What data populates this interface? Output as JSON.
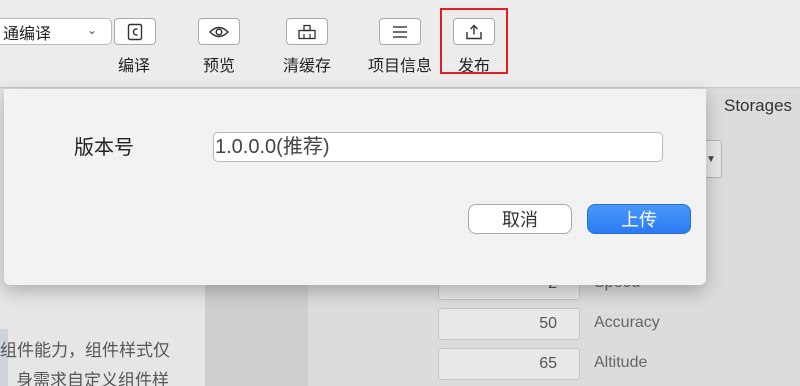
{
  "toolbar": {
    "mode_select": "通编译",
    "compile_label": "编译",
    "preview_label": "预览",
    "clear_cache_label": "清缓存",
    "project_info_label": "项目信息",
    "publish_label": "发布"
  },
  "right_panel": {
    "storages_tab": "Storages",
    "fields": [
      {
        "value": "2",
        "label": "Speed"
      },
      {
        "value": "50",
        "label": "Accuracy"
      },
      {
        "value": "65",
        "label": "Altitude"
      }
    ]
  },
  "left_panel": {
    "text_line1": "组件能力，组件样式仅",
    "text_line2": "身需求自定义组件样"
  },
  "dialog": {
    "version_label": "版本号",
    "version_value": "1.0.0.0(推荐)",
    "cancel_label": "取消",
    "upload_label": "上传"
  },
  "colors": {
    "highlight": "#e02020",
    "primary": "#2a7cf2"
  }
}
